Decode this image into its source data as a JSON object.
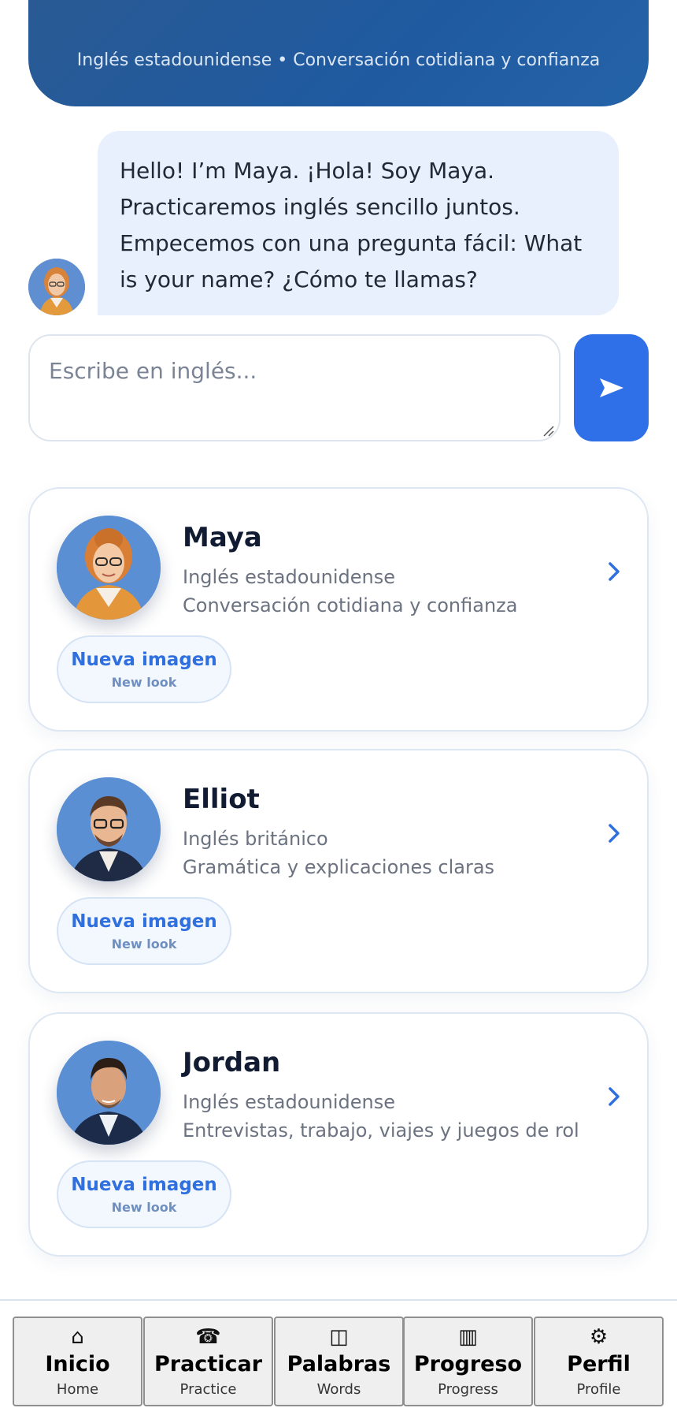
{
  "header": {
    "subtitle": "Inglés estadounidense • Conversación cotidiana y confianza"
  },
  "chat": {
    "message": "Hello! I’m Maya. ¡Hola! Soy Maya. Practicaremos inglés sencillo juntos. Empecemos con una pregunta fácil: What is your name? ¿Cómo te llamas?",
    "input_placeholder": "Escribe en inglés...",
    "send_icon": "send-arrow-icon"
  },
  "tutors": [
    {
      "name": "Maya",
      "accent": "Inglés estadounidense",
      "focus": "Conversación cotidiana y confianza",
      "button_label": "Nueva imagen",
      "button_sub": "New look"
    },
    {
      "name": "Elliot",
      "accent": "Inglés británico",
      "focus": "Gramática y explicaciones claras",
      "button_label": "Nueva imagen",
      "button_sub": "New look"
    },
    {
      "name": "Jordan",
      "accent": "Inglés estadounidense",
      "focus": "Entrevistas, trabajo, viajes y juegos de rol",
      "button_label": "Nueva imagen",
      "button_sub": "New look"
    }
  ],
  "nav": [
    {
      "icon": "⌂",
      "label": "Inicio",
      "sub": "Home"
    },
    {
      "icon": "☎",
      "label": "Practicar",
      "sub": "Practice"
    },
    {
      "icon": "◫",
      "label": "Palabras",
      "sub": "Words"
    },
    {
      "icon": "▥",
      "label": "Progreso",
      "sub": "Progress"
    },
    {
      "icon": "⚙",
      "label": "Perfil",
      "sub": "Profile"
    }
  ],
  "colors": {
    "header": "#1f5aa0",
    "accent": "#2f6fe8",
    "bubble": "#e8f0fd"
  }
}
